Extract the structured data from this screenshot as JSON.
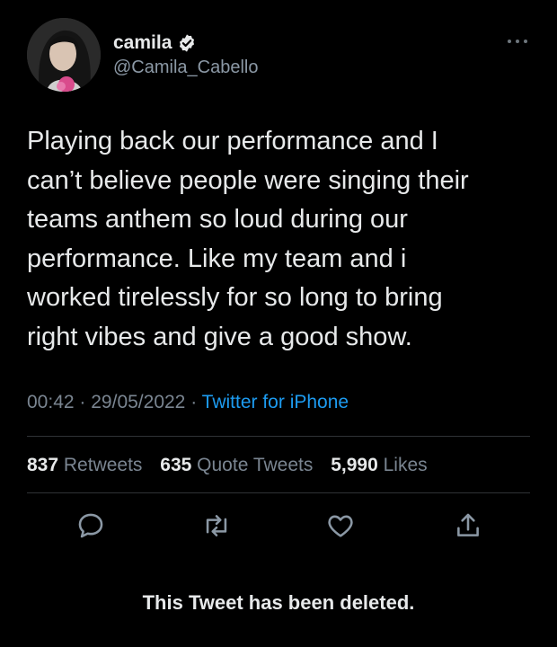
{
  "user": {
    "display_name": "camila",
    "handle": "@Camila_Cabello",
    "verified": true,
    "avatar_icon": "profile-photo"
  },
  "tweet": {
    "text": "Playing back our performance and I\ncan’t believe people were singing their\nteams anthem so loud during our\nperformance. Like my team and i\nworked tirelessly for so long to bring\nright vibes and give a good show.",
    "time": "00:42",
    "date": "29/05/2022",
    "separator": "·",
    "source": "Twitter for iPhone"
  },
  "stats": {
    "retweets_count": "837",
    "retweets_label": "Retweets",
    "quotes_count": "635",
    "quotes_label": "Quote Tweets",
    "likes_count": "5,990",
    "likes_label": "Likes"
  },
  "actions": [
    {
      "icon": "reply-icon"
    },
    {
      "icon": "retweet-icon"
    },
    {
      "icon": "like-icon"
    },
    {
      "icon": "share-icon"
    }
  ],
  "notice": "This Tweet has been deleted.",
  "colors": {
    "background": "#000000",
    "text": "#e7e9ea",
    "muted": "#7a8591",
    "accent": "#1d9bf0",
    "divider": "#2f3336"
  }
}
